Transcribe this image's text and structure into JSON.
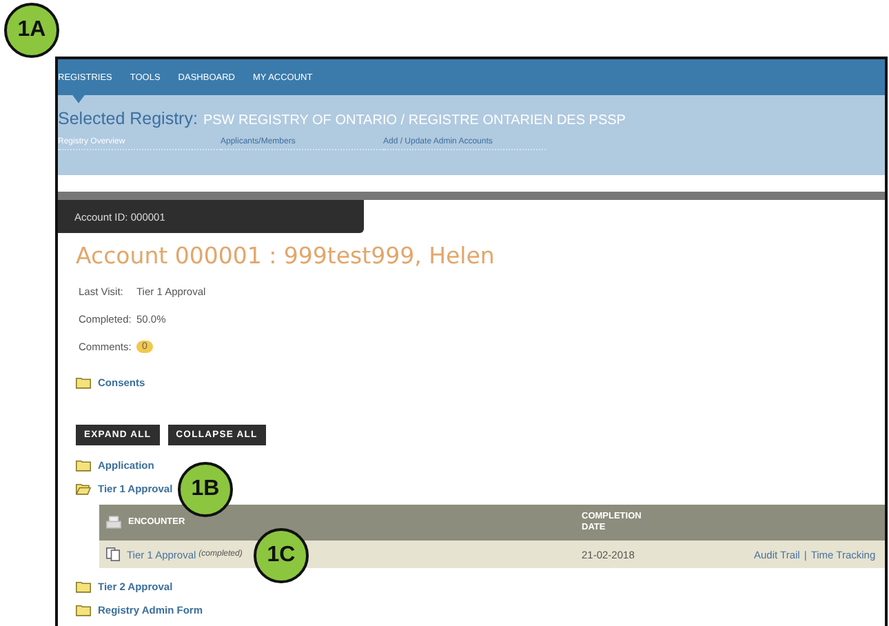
{
  "callouts": [
    {
      "label": "1A"
    },
    {
      "label": "1B"
    },
    {
      "label": "1C"
    }
  ],
  "nav": {
    "items": [
      {
        "label": "REGISTRIES",
        "selected": true
      },
      {
        "label": "TOOLS",
        "selected": false
      },
      {
        "label": "DASHBOARD",
        "selected": false
      },
      {
        "label": "MY ACCOUNT",
        "selected": false
      }
    ]
  },
  "registry": {
    "label": "Selected Registry:",
    "name": "PSW REGISTRY OF ONTARIO / REGISTRE ONTARIEN DES PSSP"
  },
  "subtabs": [
    {
      "label": "Registry Overview",
      "selected": true
    },
    {
      "label": "Applicants/Members",
      "selected": false
    },
    {
      "label": "Add / Update Admin Accounts",
      "selected": false
    }
  ],
  "account_tab": "Account ID: 000001",
  "heading": "Account 000001 : 999test999, Helen",
  "details": [
    {
      "label": "Last Visit:",
      "value": "Tier 1 Approval"
    },
    {
      "label": "Completed:",
      "value": "50.0%"
    },
    {
      "label": "Comments:",
      "badge": "0"
    }
  ],
  "consents": {
    "label": "Consents",
    "expanded": false
  },
  "buttons": [
    "EXPAND ALL",
    "COLLAPSE ALL"
  ],
  "sections": [
    {
      "label": "Application",
      "expanded": false
    },
    {
      "label": "Tier 1 Approval",
      "expanded": true,
      "table": {
        "columns": [
          "ENCOUNTER",
          "COMPLETION\nDATE"
        ],
        "rows": [
          {
            "name": "Tier 1 Approval",
            "status": "(completed)",
            "date": "21-02-2018",
            "links": [
              "Audit Trail",
              "Time Tracking"
            ],
            "separator": "|"
          }
        ]
      }
    },
    {
      "label": "Tier 2 Approval",
      "expanded": false
    },
    {
      "label": "Registry Admin Form",
      "expanded": false
    }
  ]
}
